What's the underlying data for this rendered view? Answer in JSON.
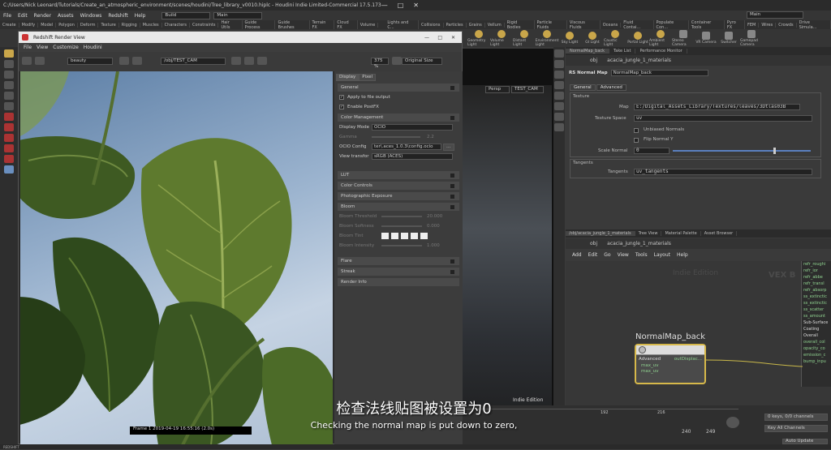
{
  "window": {
    "title": "C:/Users/Nick Leonard/Tutorials/Create_an_atmospheric_environment/scenes/houdini/Tree_library_v0010.hiplc - Houdini Indie Limited-Commercial 17.5.173"
  },
  "menu": {
    "items": [
      "File",
      "Edit",
      "Render",
      "Assets",
      "Windows",
      "Redshift",
      "Help"
    ],
    "build": "Build",
    "main": "Main",
    "main_right": "Main"
  },
  "shelf": {
    "tabs": [
      "Create",
      "Modify",
      "Model",
      "Polygon",
      "Deform",
      "Texture",
      "Rigging",
      "Muscles",
      "Characters",
      "Constraints",
      "Hair Utils",
      "Guide Process",
      "Guide Brushes",
      "Terrain FX",
      "Cloud FX",
      "Volume"
    ],
    "tabs_right": [
      "Lights and C...",
      "Collisions",
      "Particles",
      "Grains",
      "Vellum",
      "Rigid Bodies",
      "Particle Fluids",
      "Viscous Fluids",
      "Oceans",
      "Fluid Contai...",
      "Populate Con...",
      "Container Tools",
      "Pyro FX",
      "FEM",
      "Wires",
      "Crowds",
      "Drive Simula..."
    ],
    "icons": [
      "Geometry Light",
      "Volume Light",
      "Distant Light",
      "Environment Light",
      "Sky Light",
      "GI Light",
      "Caustic Light",
      "Portal Light",
      "Ambient Light",
      "Stereo Camera",
      "VR Camera",
      "Switcher",
      "Gamepad Camera"
    ]
  },
  "render_view": {
    "title": "Redshift Render View",
    "menu": [
      "File",
      "View",
      "Customize",
      "Houdini"
    ],
    "aov": "beauty",
    "camera": "/obj/TEST_CAM",
    "zoom": "375 %",
    "size_mode": "Original Size",
    "frame_info": "Frame 1  2019-04-19  16:55:16  (2.0s)",
    "tabs": [
      "Display",
      "Pixel"
    ],
    "general_header": "General",
    "apply_to_file": "Apply to file output",
    "enable_postfx": "Enable PostFX",
    "cm_header": "Color Management",
    "display_mode_label": "Display Mode",
    "display_mode": "OCIO",
    "gamma_label": "Gamma",
    "gamma": "2.2",
    "ocio_label": "OCIO Config",
    "ocio_value": "ter\\.aces_1.0.3\\config.ocio",
    "view_transform_label": "View transfor",
    "view_transform": "sRGB (ACES)",
    "sections": [
      "LUT",
      "Color Controls",
      "Photographic Exposure",
      "Bloom"
    ],
    "bloom_threshold_label": "Bloom Threshold",
    "bloom_threshold": "20.000",
    "bloom_softness_label": "Bloom Softness",
    "bloom_softness": "0.000",
    "bloom_tint_label": "Bloom Tint",
    "bloom_intensity_label": "Bloom Intensity",
    "bloom_intensity": "1.000",
    "sections2": [
      "Flare",
      "Streak",
      "Render Info"
    ]
  },
  "viewport": {
    "persp": "Persp",
    "cam": "TEST_CAM",
    "badge": "Indie Edition"
  },
  "params": {
    "tabs": [
      "NormalMap_back",
      "Take List",
      "Performance Monitor"
    ],
    "path_obj": "obj",
    "path_mat": "acacia_jungle_1_materials",
    "node_type": "RS Normal Map",
    "node_name": "NormalMap_back",
    "sub_tabs": [
      "General",
      "Advanced"
    ],
    "texture_header": "Texture",
    "map_label": "Map",
    "map_value": "E:/Digital_Assets_Library/Textures/leaves/3Dtlas03B",
    "tex_space_label": "Texture Space",
    "tex_space_value": "uv",
    "unbiased": "Unbiased Normals",
    "flip": "Flip Normal Y",
    "scale_label": "Scale Normal",
    "scale_value": "0",
    "tangents_header": "Tangents",
    "tangents_label": "Tangents",
    "tangents_value": "uv_tangents"
  },
  "network": {
    "tabs": [
      "/obj/acacia_jungle_1_materials",
      "Tree View",
      "Material Palette",
      "Asset Browser"
    ],
    "path_obj": "obj",
    "path_mat": "acacia_jungle_1_materials",
    "menu": [
      "Add",
      "Edit",
      "Go",
      "View",
      "Tools",
      "Layout",
      "Help"
    ],
    "watermark": "Indie Edition",
    "vex": "VEX B",
    "node_title": "NormalMap_back",
    "node_adv": "Advanced",
    "node_out": "outDisplac...",
    "node_ports": [
      "max_uv",
      "max_uv"
    ],
    "right_ports": [
      "refr_roughi",
      "refr_ior",
      "refr_abbe",
      "refr_transl",
      "refr_absorp",
      "ss_extinctic",
      "ss_extinctic",
      "ss_scatter",
      "ss_amount",
      "Sub-Surface",
      "Coating",
      "Overall",
      "overall_col",
      "opacity_co",
      "emission_c",
      "bump_inpu"
    ]
  },
  "timeline": {
    "ticks": [
      "192",
      "216"
    ],
    "frame_a": "240",
    "frame_b": "249",
    "keys": "0 keys, 0/0 channels",
    "key_all": "Key All Channels",
    "auto_update": "Auto Update"
  },
  "subtitles": {
    "cn": "检查法线贴图被设置为0",
    "en": "Checking the normal map is put down to zero,"
  },
  "status": {
    "left": "REDSHIFT"
  }
}
